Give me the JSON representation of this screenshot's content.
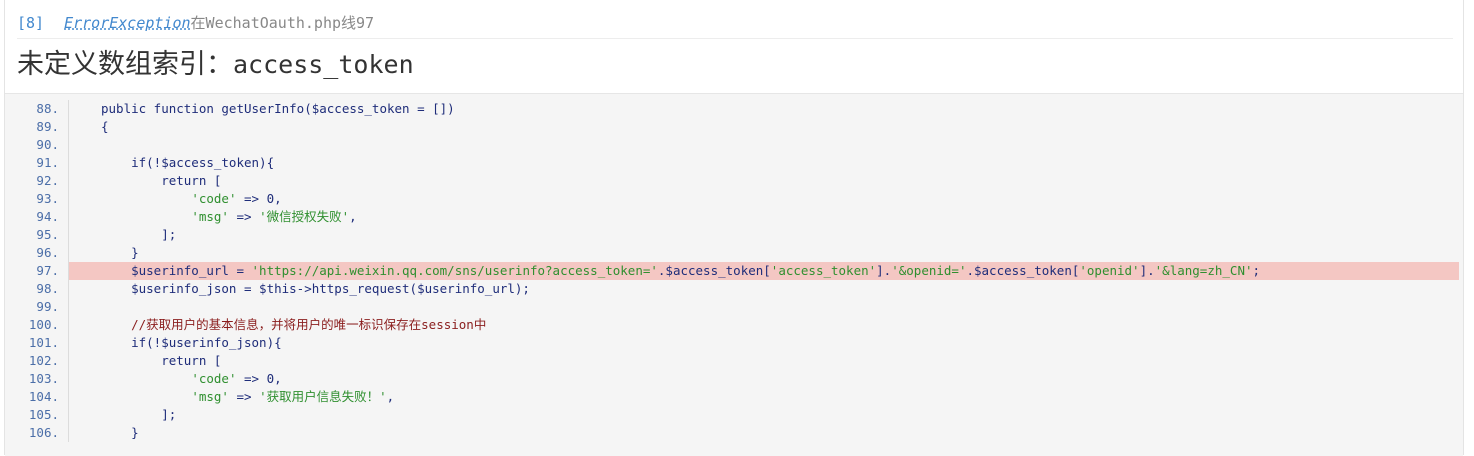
{
  "header": {
    "code": "[8]",
    "exception": "ErrorException",
    "location_prefix": "在",
    "file": "WechatOauth.php",
    "line_prefix": "线",
    "line": "97"
  },
  "message": {
    "cn": "未定义数组索引：",
    "key": "access_token"
  },
  "source": {
    "highlight_line": "97.",
    "lines": [
      {
        "n": "88.",
        "code": "public function getUserInfo($access_token = [])"
      },
      {
        "n": "89.",
        "code": "{"
      },
      {
        "n": "90.",
        "code": ""
      },
      {
        "n": "91.",
        "code": "    if(!$access_token){"
      },
      {
        "n": "92.",
        "code": "        return ["
      },
      {
        "n": "93.",
        "code": "            'code' => 0,"
      },
      {
        "n": "94.",
        "code": "            'msg' => '微信授权失败',"
      },
      {
        "n": "95.",
        "code": "        ];"
      },
      {
        "n": "96.",
        "code": "    }"
      },
      {
        "n": "97.",
        "code": "    $userinfo_url = 'https://api.weixin.qq.com/sns/userinfo?access_token='.$access_token['access_token'].'&openid='.$access_token['openid'].'&lang=zh_CN';"
      },
      {
        "n": "98.",
        "code": "    $userinfo_json = $this->https_request($userinfo_url);"
      },
      {
        "n": "99.",
        "code": ""
      },
      {
        "n": "100.",
        "code": "    //获取用户的基本信息，并将用户的唯一标识保存在session中"
      },
      {
        "n": "101.",
        "code": "    if(!$userinfo_json){"
      },
      {
        "n": "102.",
        "code": "        return ["
      },
      {
        "n": "103.",
        "code": "            'code' => 0,"
      },
      {
        "n": "104.",
        "code": "            'msg' => '获取用户信息失败！',"
      },
      {
        "n": "105.",
        "code": "        ];"
      },
      {
        "n": "106.",
        "code": "    }"
      }
    ]
  },
  "colors": {
    "highlight": "#f4c7c3",
    "line_number": "#4b6ea8",
    "string": "#2f8f2f",
    "keyword": "#1f2d7a",
    "comment": "#8a1d1d",
    "link": "#4288ce"
  }
}
